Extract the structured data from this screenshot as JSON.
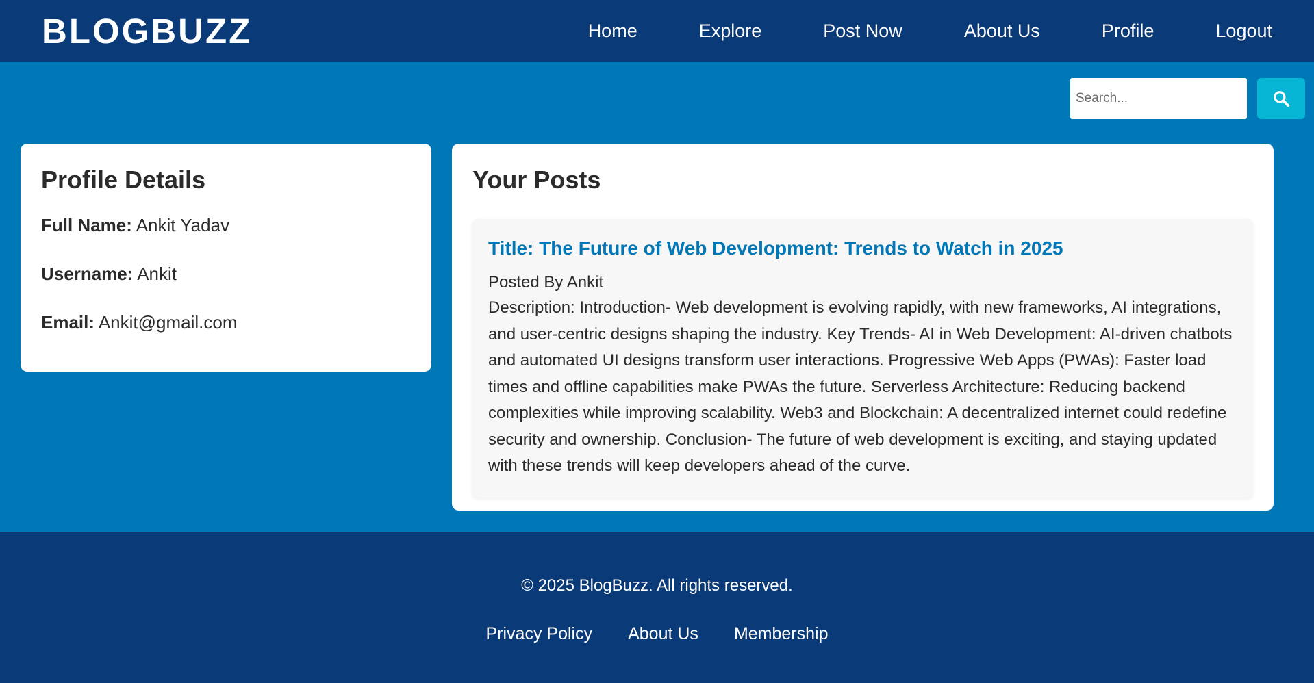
{
  "brand": {
    "logo": "BLOGBUZZ"
  },
  "nav": {
    "items": [
      {
        "label": "Home"
      },
      {
        "label": "Explore"
      },
      {
        "label": "Post Now"
      },
      {
        "label": "About Us"
      },
      {
        "label": "Profile"
      },
      {
        "label": "Logout"
      }
    ]
  },
  "search": {
    "placeholder": "Search...",
    "value": "",
    "button_icon": "search-icon"
  },
  "profile": {
    "title": "Profile Details",
    "fields": [
      {
        "label": "Full Name:",
        "value": "Ankit Yadav"
      },
      {
        "label": "Username:",
        "value": "Ankit"
      },
      {
        "label": "Email:",
        "value": "Ankit@gmail.com"
      }
    ]
  },
  "posts": {
    "title": "Your Posts",
    "items": [
      {
        "title": "Title: The Future of Web Development: Trends to Watch in 2025",
        "author": "Posted By Ankit",
        "description": "Description: Introduction- Web development is evolving rapidly, with new frameworks, AI integrations, and user-centric designs shaping the industry. Key Trends- AI in Web Development: AI-driven chatbots and automated UI designs transform user interactions. Progressive Web Apps (PWAs): Faster load times and offline capabilities make PWAs the future. Serverless Architecture: Reducing backend complexities while improving scalability. Web3 and Blockchain: A decentralized internet could redefine security and ownership. Conclusion- The future of web development is exciting, and staying updated with these trends will keep developers ahead of the curve."
      }
    ]
  },
  "footer": {
    "copyright": "© 2025 BlogBuzz. All rights reserved.",
    "links": [
      {
        "label": "Privacy Policy"
      },
      {
        "label": "About Us"
      },
      {
        "label": "Membership"
      }
    ]
  },
  "colors": {
    "navbar_bg": "#0a3a78",
    "page_bg": "#0077b6",
    "accent": "#06b6d4",
    "post_title": "#0077b6"
  }
}
